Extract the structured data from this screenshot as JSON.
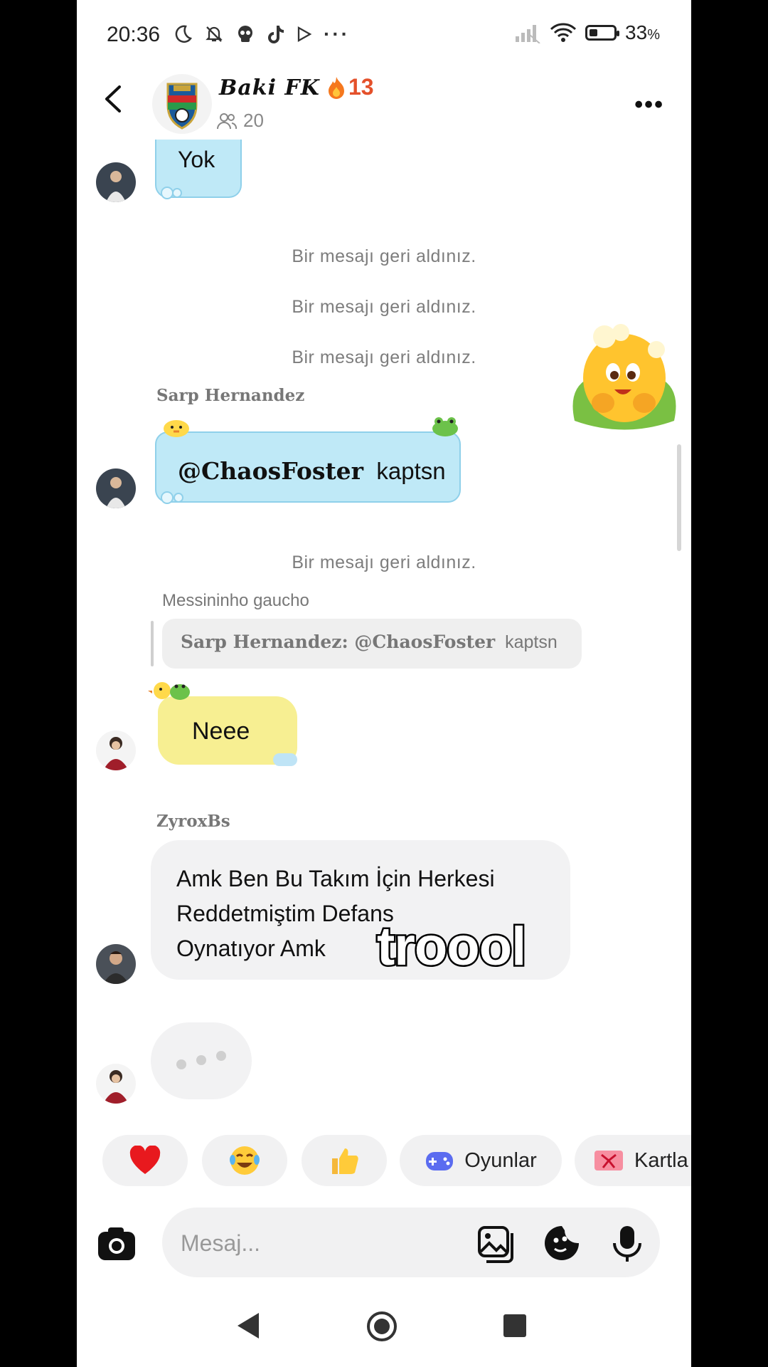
{
  "status_bar": {
    "time": "20:36",
    "battery_pct": "33",
    "battery_unit": "%",
    "battery_level": 0.33
  },
  "header": {
    "group_name": "Baki FK",
    "streak_count": "13",
    "members_count": "20"
  },
  "messages": {
    "yok": "Yok",
    "unsent": "Bir mesajı geri aldınız.",
    "sarp_sender": "Sarp Hernandez",
    "sarp_mention": "@ChaosFoster",
    "sarp_text": "kaptsn",
    "messi_sender": "Messininho gaucho",
    "reply_sender": "Sarp Hernandez: @ChaosFoster",
    "reply_text": "kaptsn",
    "neee": "Neee",
    "zyrox_sender": "ZyroxBs",
    "zyrox_line1": "Amk Ben Bu Takım İçin Herkesi",
    "zyrox_line2": "Reddetmiştim Defans",
    "zyrox_line3": "Oynatıyor Amk",
    "overlay_text": "troool"
  },
  "quick_actions": {
    "heart": "heart-emoji",
    "laugh": "tears-of-joy-emoji",
    "thumbs": "thumbs-up-emoji",
    "games_label": "Oyunlar",
    "cards_label": "Kartla"
  },
  "composer": {
    "placeholder": "Mesaj..."
  },
  "colors": {
    "accent_fire": "#e4502a",
    "bubble_blue": "#bfe9f7",
    "bubble_yellow": "#f7ef92",
    "bubble_grey": "#f2f2f3"
  }
}
